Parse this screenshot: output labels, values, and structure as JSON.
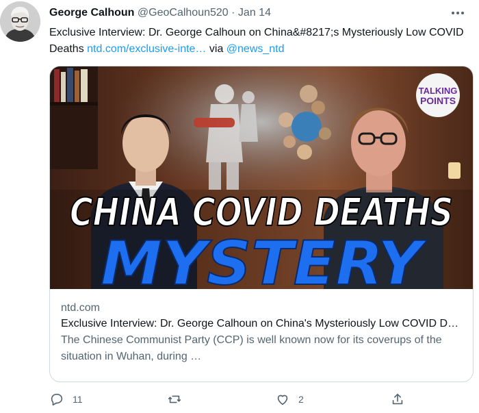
{
  "tweet": {
    "author_name": "George Calhoun",
    "handle": "@GeoCalhoun520",
    "separator": "·",
    "date": "Jan 14",
    "text_main": "Exclusive Interview: Dr. George Calhoun on China&#8217;s Mysteriously Low COVID Deaths ",
    "text_link": "ntd.com/exclusive-inte…",
    "text_via": " via ",
    "text_mention": "@news_ntd"
  },
  "card": {
    "image_headline_1": "CHINA COVID DEATHS",
    "image_headline_2": "MYSTERY",
    "badge_line1": "TALKING",
    "badge_line2": "POINTS",
    "domain": "ntd.com",
    "title": "Exclusive Interview: Dr. George Calhoun on China's Mysteriously Low COVID Deaths",
    "description": "The Chinese Communist Party (CCP) is well known now for its coverups of the situation in Wuhan, during …"
  },
  "actions": {
    "reply_count": "11",
    "retweet_count": "",
    "like_count": "2"
  },
  "colors": {
    "link": "#1d9bf0",
    "secondary_text": "#536471",
    "headline_blue": "#1e6ff0"
  }
}
